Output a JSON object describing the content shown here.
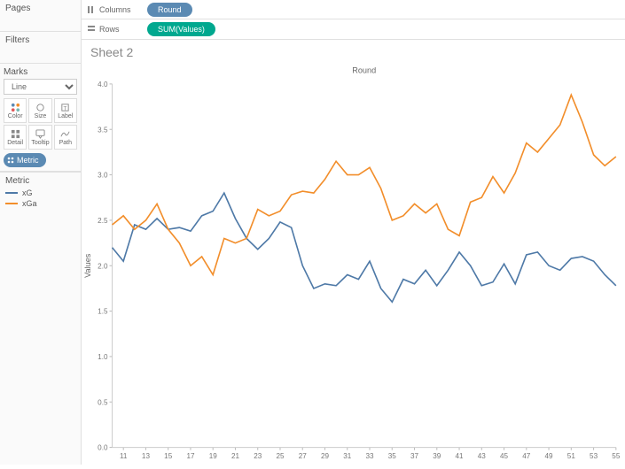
{
  "left": {
    "pages": "Pages",
    "filters": "Filters",
    "marks": "Marks",
    "mark_type": "Line",
    "cards": {
      "color": "Color",
      "size": "Size",
      "label": "Label",
      "detail": "Detail",
      "tooltip": "Tooltip",
      "path": "Path"
    },
    "metric_pill": "Metric",
    "legend_title": "Metric",
    "legend": [
      {
        "name": "xG",
        "color": "#4e79a7"
      },
      {
        "name": "xGa",
        "color": "#f28e2b"
      }
    ]
  },
  "shelves": {
    "columns_label": "Columns",
    "rows_label": "Rows",
    "columns_pill": "Round",
    "rows_pill": "SUM(Values)"
  },
  "sheet_title": "Sheet 2",
  "chart_meta": {
    "x_title": "Round",
    "y_title": "Values"
  },
  "chart_data": {
    "type": "line",
    "title": "Sheet 2",
    "xlabel": "Round",
    "ylabel": "Values",
    "ylim": [
      0.0,
      4.0
    ],
    "x_ticks": [
      11,
      13,
      15,
      17,
      19,
      21,
      23,
      25,
      27,
      29,
      31,
      33,
      35,
      37,
      39,
      41,
      43,
      45,
      47,
      49,
      51,
      53,
      55
    ],
    "y_ticks": [
      0.0,
      0.5,
      1.0,
      1.5,
      2.0,
      2.5,
      3.0,
      3.5,
      4.0
    ],
    "categories": [
      10,
      11,
      12,
      13,
      14,
      15,
      16,
      17,
      18,
      19,
      20,
      21,
      22,
      23,
      24,
      25,
      26,
      27,
      28,
      29,
      30,
      31,
      32,
      33,
      34,
      35,
      36,
      37,
      38,
      39,
      40,
      41,
      42,
      43,
      44,
      45,
      46,
      47,
      48,
      49,
      50,
      51,
      52,
      53,
      54,
      55
    ],
    "series": [
      {
        "name": "xG",
        "color": "#4e79a7",
        "values": [
          2.2,
          2.05,
          2.45,
          2.4,
          2.52,
          2.4,
          2.42,
          2.38,
          2.55,
          2.6,
          2.8,
          2.52,
          2.3,
          2.18,
          2.3,
          2.48,
          2.42,
          2.0,
          1.75,
          1.8,
          1.78,
          1.9,
          1.85,
          2.05,
          1.75,
          1.6,
          1.85,
          1.8,
          1.95,
          1.78,
          1.95,
          2.15,
          2.0,
          1.78,
          1.82,
          2.02,
          1.8,
          2.12,
          2.15,
          2.0,
          1.95,
          2.08,
          2.1,
          2.05,
          1.9,
          1.78
        ]
      },
      {
        "name": "xGa",
        "color": "#f28e2b",
        "values": [
          2.45,
          2.55,
          2.4,
          2.5,
          2.68,
          2.4,
          2.25,
          2.0,
          2.1,
          1.9,
          2.3,
          2.25,
          2.3,
          2.62,
          2.55,
          2.6,
          2.78,
          2.82,
          2.8,
          2.95,
          3.15,
          3.0,
          3.0,
          3.08,
          2.85,
          2.5,
          2.55,
          2.68,
          2.58,
          2.68,
          2.4,
          2.33,
          2.7,
          2.75,
          2.98,
          2.8,
          3.02,
          3.35,
          3.25,
          3.4,
          3.55,
          3.88,
          3.58,
          3.22,
          3.1,
          3.2
        ]
      }
    ]
  }
}
